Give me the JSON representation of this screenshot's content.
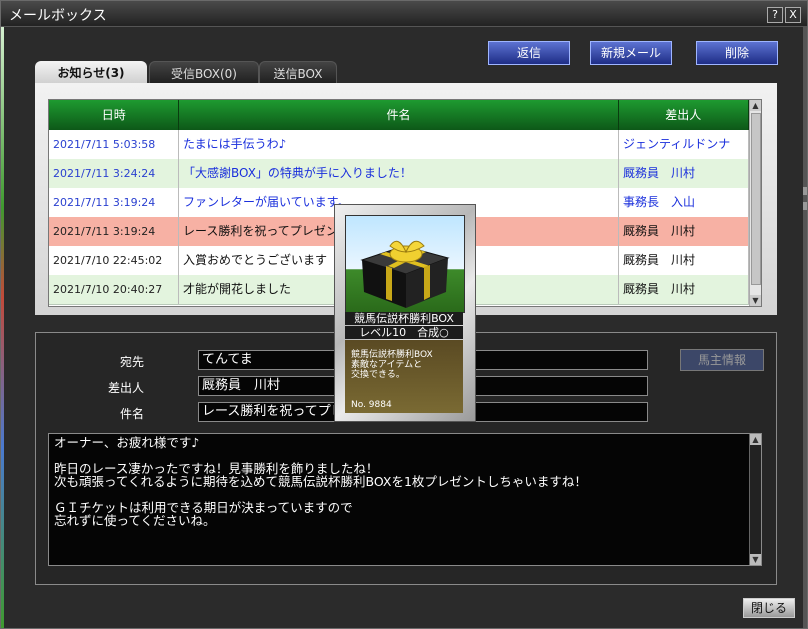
{
  "window": {
    "title": "メールボックス",
    "help_label": "?",
    "close_label": "X"
  },
  "actions": {
    "reply": "返信",
    "new_mail": "新規メール",
    "delete": "削除"
  },
  "tabs": [
    {
      "label": "お知らせ(3)"
    },
    {
      "label": "受信BOX(0)"
    },
    {
      "label": "送信BOX"
    }
  ],
  "mail_list": {
    "headers": {
      "date": "日時",
      "subject": "件名",
      "sender": "差出人"
    },
    "rows": [
      {
        "date": "2021/7/11 5:03:58",
        "subject": "たまには手伝うわ♪",
        "sender": "ジェンティルドンナ"
      },
      {
        "date": "2021/7/11 3:24:24",
        "subject": "「大感謝BOX」の特典が手に入りました！",
        "sender": "厩務員　川村"
      },
      {
        "date": "2021/7/11 3:19:24",
        "subject": "ファンレターが届いています。",
        "sender": "事務長　入山"
      },
      {
        "date": "2021/7/11 3:19:24",
        "subject": "レース勝利を祝ってプレゼント",
        "sender": "厩務員　川村"
      },
      {
        "date": "2021/7/10 22:45:02",
        "subject": "入賞おめでとうございます",
        "sender": "厩務員　川村"
      },
      {
        "date": "2021/7/10 20:40:27",
        "subject": "才能が開花しました",
        "sender": "厩務員　川村"
      }
    ]
  },
  "detail": {
    "to_label": "宛先",
    "to_value": "てんてま",
    "from_label": "差出人",
    "from_value": "厩務員　川村",
    "subject_label": "件名",
    "subject_value": "レース勝利を祝ってプレゼント",
    "owner_info_label": "馬主情報",
    "body_lines": [
      "オーナー、お疲れ様です♪",
      "",
      "昨日のレース凄かったですね！見事勝利を飾りましたね！",
      "次も頑張ってくれるように期待を込めて競馬伝説杯勝利BOXを1枚プレゼントしちゃいますね！",
      "",
      "ＧＩチケットは利用できる期日が決まっていますので",
      "忘れずに使ってくださいね。"
    ]
  },
  "item_card": {
    "name": "競馬伝説杯勝利BOX",
    "level": "レベル10　合成○",
    "desc_lines": [
      "競馬伝説杯勝利BOX",
      "素敵なアイテムと",
      "交換できる。"
    ],
    "number": "No. 9884"
  },
  "footer": {
    "close_label": "閉じる"
  },
  "colors": {
    "header_green": "#1e9a30",
    "row_selected": "#f7b1a4",
    "row_alt": "#e3f4de",
    "date_blue": "#2a40d0",
    "link_blue": "#1a2fdc",
    "button_blue": "#2b3ea8"
  }
}
